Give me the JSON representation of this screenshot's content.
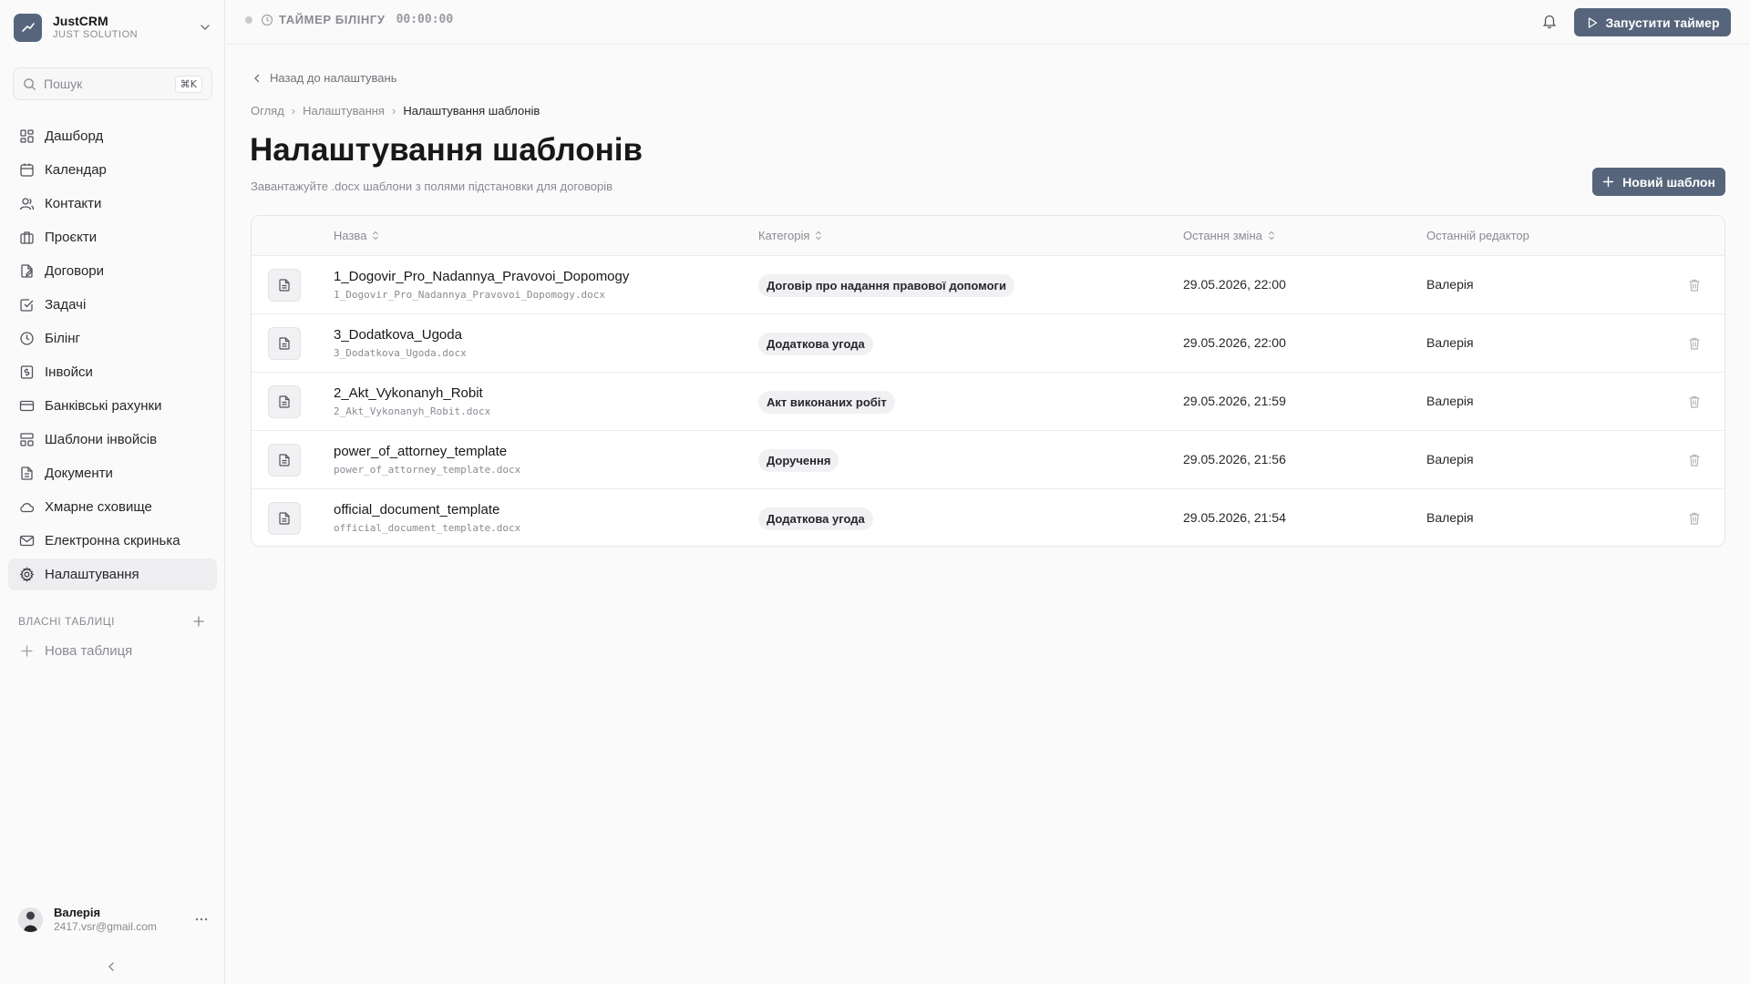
{
  "app": {
    "name": "JustCRM",
    "subtitle": "JUST SOLUTION"
  },
  "search": {
    "placeholder": "Пошук",
    "shortcut": "⌘K"
  },
  "sidebar": {
    "items": [
      {
        "label": "Дашборд",
        "icon": "dashboard-icon",
        "active": false
      },
      {
        "label": "Календар",
        "icon": "calendar-icon",
        "active": false
      },
      {
        "label": "Контакти",
        "icon": "contacts-icon",
        "active": false
      },
      {
        "label": "Проєкти",
        "icon": "briefcase-icon",
        "active": false
      },
      {
        "label": "Договори",
        "icon": "contract-icon",
        "active": false
      },
      {
        "label": "Задачі",
        "icon": "checkbox-icon",
        "active": false
      },
      {
        "label": "Білінг",
        "icon": "clock-icon",
        "active": false
      },
      {
        "label": "Інвойси",
        "icon": "invoice-icon",
        "active": false
      },
      {
        "label": "Банківські рахунки",
        "icon": "credit-card-icon",
        "active": false
      },
      {
        "label": "Шаблони інвойсів",
        "icon": "template-icon",
        "active": false
      },
      {
        "label": "Документи",
        "icon": "document-icon",
        "active": false
      },
      {
        "label": "Хмарне сховище",
        "icon": "cloud-icon",
        "active": false
      },
      {
        "label": "Електронна скринька",
        "icon": "mail-icon",
        "active": false
      },
      {
        "label": "Налаштування",
        "icon": "gear-icon",
        "active": true
      }
    ],
    "custom_tables_title": "ВЛАСНІ ТАБЛИЦІ",
    "new_table_label": "Нова таблиця"
  },
  "user": {
    "name": "Валерія",
    "email": "2417.vsr@gmail.com"
  },
  "topbar": {
    "timer_label": "ТАЙМЕР БІЛІНГУ",
    "timer_value": "00:00:00",
    "start_button": "Запустити таймер"
  },
  "page": {
    "back_link": "Назад до налаштувань",
    "breadcrumb": [
      "Огляд",
      "Налаштування",
      "Налаштування шаблонів"
    ],
    "title": "Налаштування шаблонів",
    "subtitle": "Завантажуйте .docx шаблони з полями підстановки для договорів",
    "new_button": "Новий шаблон"
  },
  "table": {
    "columns": [
      "Назва",
      "Категорія",
      "Остання зміна",
      "Останній редактор"
    ],
    "rows": [
      {
        "name": "1_Dogovir_Pro_Nadannya_Pravovoi_Dopomogy",
        "file": "1_Dogovir_Pro_Nadannya_Pravovoi_Dopomogy.docx",
        "category": "Договір про надання правової допомоги",
        "modified": "29.05.2026, 22:00",
        "editor": "Валерія"
      },
      {
        "name": "3_Dodatkova_Ugoda",
        "file": "3_Dodatkova_Ugoda.docx",
        "category": "Додаткова угода",
        "modified": "29.05.2026, 22:00",
        "editor": "Валерія"
      },
      {
        "name": "2_Akt_Vykonanyh_Robit",
        "file": "2_Akt_Vykonanyh_Robit.docx",
        "category": "Акт виконаних робіт",
        "modified": "29.05.2026, 21:59",
        "editor": "Валерія"
      },
      {
        "name": "power_of_attorney_template",
        "file": "power_of_attorney_template.docx",
        "category": "Доручення",
        "modified": "29.05.2026, 21:56",
        "editor": "Валерія"
      },
      {
        "name": "official_document_template",
        "file": "official_document_template.docx",
        "category": "Додаткова угода",
        "modified": "29.05.2026, 21:54",
        "editor": "Валерія"
      }
    ]
  },
  "colors": {
    "accent": "#56657b",
    "background": "#fafafa",
    "text": "#18181b",
    "muted": "#8a8a93"
  }
}
